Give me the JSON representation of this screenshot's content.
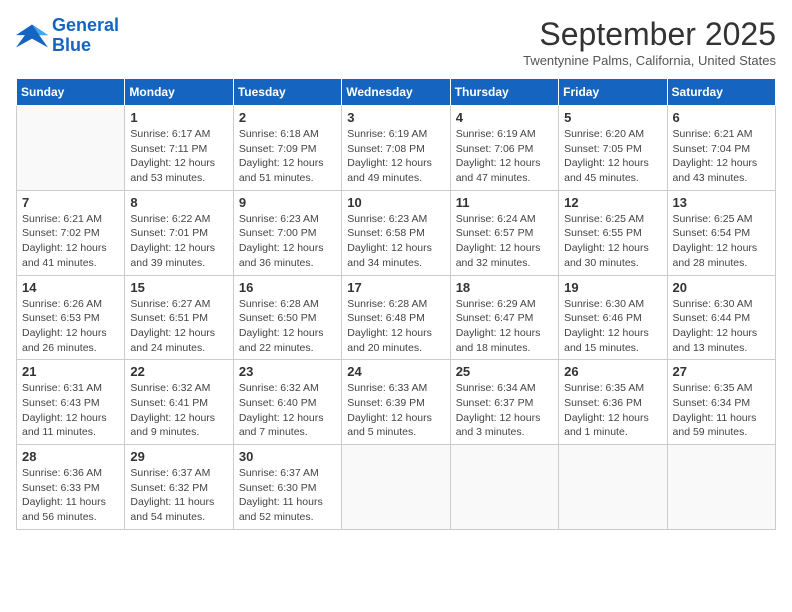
{
  "logo": {
    "line1": "General",
    "line2": "Blue"
  },
  "title": "September 2025",
  "location": "Twentynine Palms, California, United States",
  "weekdays": [
    "Sunday",
    "Monday",
    "Tuesday",
    "Wednesday",
    "Thursday",
    "Friday",
    "Saturday"
  ],
  "weeks": [
    [
      {
        "day": "",
        "sunrise": "",
        "sunset": "",
        "daylight": ""
      },
      {
        "day": "1",
        "sunrise": "Sunrise: 6:17 AM",
        "sunset": "Sunset: 7:11 PM",
        "daylight": "Daylight: 12 hours and 53 minutes."
      },
      {
        "day": "2",
        "sunrise": "Sunrise: 6:18 AM",
        "sunset": "Sunset: 7:09 PM",
        "daylight": "Daylight: 12 hours and 51 minutes."
      },
      {
        "day": "3",
        "sunrise": "Sunrise: 6:19 AM",
        "sunset": "Sunset: 7:08 PM",
        "daylight": "Daylight: 12 hours and 49 minutes."
      },
      {
        "day": "4",
        "sunrise": "Sunrise: 6:19 AM",
        "sunset": "Sunset: 7:06 PM",
        "daylight": "Daylight: 12 hours and 47 minutes."
      },
      {
        "day": "5",
        "sunrise": "Sunrise: 6:20 AM",
        "sunset": "Sunset: 7:05 PM",
        "daylight": "Daylight: 12 hours and 45 minutes."
      },
      {
        "day": "6",
        "sunrise": "Sunrise: 6:21 AM",
        "sunset": "Sunset: 7:04 PM",
        "daylight": "Daylight: 12 hours and 43 minutes."
      }
    ],
    [
      {
        "day": "7",
        "sunrise": "Sunrise: 6:21 AM",
        "sunset": "Sunset: 7:02 PM",
        "daylight": "Daylight: 12 hours and 41 minutes."
      },
      {
        "day": "8",
        "sunrise": "Sunrise: 6:22 AM",
        "sunset": "Sunset: 7:01 PM",
        "daylight": "Daylight: 12 hours and 39 minutes."
      },
      {
        "day": "9",
        "sunrise": "Sunrise: 6:23 AM",
        "sunset": "Sunset: 7:00 PM",
        "daylight": "Daylight: 12 hours and 36 minutes."
      },
      {
        "day": "10",
        "sunrise": "Sunrise: 6:23 AM",
        "sunset": "Sunset: 6:58 PM",
        "daylight": "Daylight: 12 hours and 34 minutes."
      },
      {
        "day": "11",
        "sunrise": "Sunrise: 6:24 AM",
        "sunset": "Sunset: 6:57 PM",
        "daylight": "Daylight: 12 hours and 32 minutes."
      },
      {
        "day": "12",
        "sunrise": "Sunrise: 6:25 AM",
        "sunset": "Sunset: 6:55 PM",
        "daylight": "Daylight: 12 hours and 30 minutes."
      },
      {
        "day": "13",
        "sunrise": "Sunrise: 6:25 AM",
        "sunset": "Sunset: 6:54 PM",
        "daylight": "Daylight: 12 hours and 28 minutes."
      }
    ],
    [
      {
        "day": "14",
        "sunrise": "Sunrise: 6:26 AM",
        "sunset": "Sunset: 6:53 PM",
        "daylight": "Daylight: 12 hours and 26 minutes."
      },
      {
        "day": "15",
        "sunrise": "Sunrise: 6:27 AM",
        "sunset": "Sunset: 6:51 PM",
        "daylight": "Daylight: 12 hours and 24 minutes."
      },
      {
        "day": "16",
        "sunrise": "Sunrise: 6:28 AM",
        "sunset": "Sunset: 6:50 PM",
        "daylight": "Daylight: 12 hours and 22 minutes."
      },
      {
        "day": "17",
        "sunrise": "Sunrise: 6:28 AM",
        "sunset": "Sunset: 6:48 PM",
        "daylight": "Daylight: 12 hours and 20 minutes."
      },
      {
        "day": "18",
        "sunrise": "Sunrise: 6:29 AM",
        "sunset": "Sunset: 6:47 PM",
        "daylight": "Daylight: 12 hours and 18 minutes."
      },
      {
        "day": "19",
        "sunrise": "Sunrise: 6:30 AM",
        "sunset": "Sunset: 6:46 PM",
        "daylight": "Daylight: 12 hours and 15 minutes."
      },
      {
        "day": "20",
        "sunrise": "Sunrise: 6:30 AM",
        "sunset": "Sunset: 6:44 PM",
        "daylight": "Daylight: 12 hours and 13 minutes."
      }
    ],
    [
      {
        "day": "21",
        "sunrise": "Sunrise: 6:31 AM",
        "sunset": "Sunset: 6:43 PM",
        "daylight": "Daylight: 12 hours and 11 minutes."
      },
      {
        "day": "22",
        "sunrise": "Sunrise: 6:32 AM",
        "sunset": "Sunset: 6:41 PM",
        "daylight": "Daylight: 12 hours and 9 minutes."
      },
      {
        "day": "23",
        "sunrise": "Sunrise: 6:32 AM",
        "sunset": "Sunset: 6:40 PM",
        "daylight": "Daylight: 12 hours and 7 minutes."
      },
      {
        "day": "24",
        "sunrise": "Sunrise: 6:33 AM",
        "sunset": "Sunset: 6:39 PM",
        "daylight": "Daylight: 12 hours and 5 minutes."
      },
      {
        "day": "25",
        "sunrise": "Sunrise: 6:34 AM",
        "sunset": "Sunset: 6:37 PM",
        "daylight": "Daylight: 12 hours and 3 minutes."
      },
      {
        "day": "26",
        "sunrise": "Sunrise: 6:35 AM",
        "sunset": "Sunset: 6:36 PM",
        "daylight": "Daylight: 12 hours and 1 minute."
      },
      {
        "day": "27",
        "sunrise": "Sunrise: 6:35 AM",
        "sunset": "Sunset: 6:34 PM",
        "daylight": "Daylight: 11 hours and 59 minutes."
      }
    ],
    [
      {
        "day": "28",
        "sunrise": "Sunrise: 6:36 AM",
        "sunset": "Sunset: 6:33 PM",
        "daylight": "Daylight: 11 hours and 56 minutes."
      },
      {
        "day": "29",
        "sunrise": "Sunrise: 6:37 AM",
        "sunset": "Sunset: 6:32 PM",
        "daylight": "Daylight: 11 hours and 54 minutes."
      },
      {
        "day": "30",
        "sunrise": "Sunrise: 6:37 AM",
        "sunset": "Sunset: 6:30 PM",
        "daylight": "Daylight: 11 hours and 52 minutes."
      },
      {
        "day": "",
        "sunrise": "",
        "sunset": "",
        "daylight": ""
      },
      {
        "day": "",
        "sunrise": "",
        "sunset": "",
        "daylight": ""
      },
      {
        "day": "",
        "sunrise": "",
        "sunset": "",
        "daylight": ""
      },
      {
        "day": "",
        "sunrise": "",
        "sunset": "",
        "daylight": ""
      }
    ]
  ]
}
